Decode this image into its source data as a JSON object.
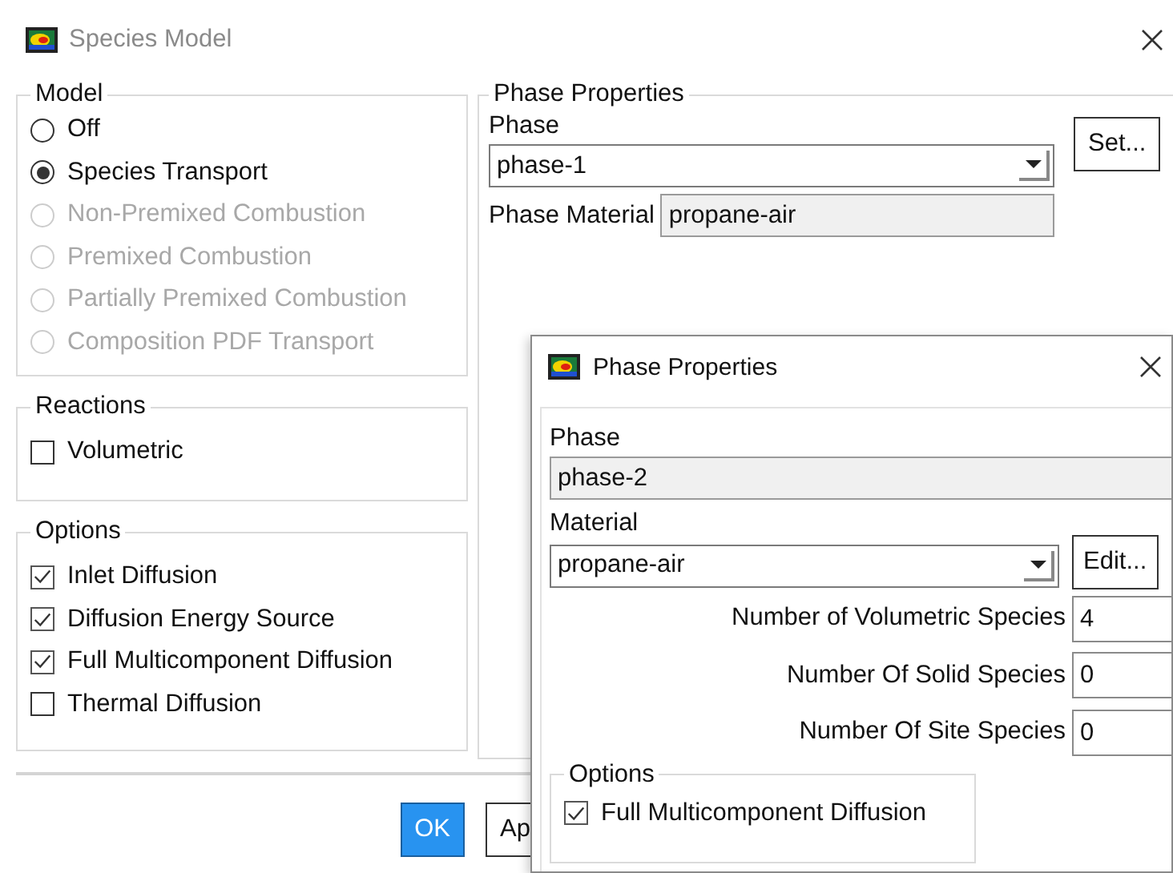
{
  "window": {
    "title": "Species Model"
  },
  "model": {
    "title": "Model",
    "options": [
      {
        "label": "Off",
        "selected": false,
        "disabled": false
      },
      {
        "label": "Species Transport",
        "selected": true,
        "disabled": false
      },
      {
        "label": "Non-Premixed Combustion",
        "selected": false,
        "disabled": true
      },
      {
        "label": "Premixed Combustion",
        "selected": false,
        "disabled": true
      },
      {
        "label": "Partially Premixed Combustion",
        "selected": false,
        "disabled": true
      },
      {
        "label": "Composition PDF Transport",
        "selected": false,
        "disabled": true
      }
    ]
  },
  "reactions": {
    "title": "Reactions",
    "items": [
      {
        "label": "Volumetric",
        "checked": false
      }
    ]
  },
  "options": {
    "title": "Options",
    "items": [
      {
        "label": "Inlet Diffusion",
        "checked": true
      },
      {
        "label": "Diffusion Energy Source",
        "checked": true
      },
      {
        "label": "Full Multicomponent Diffusion",
        "checked": true
      },
      {
        "label": "Thermal Diffusion",
        "checked": false
      }
    ]
  },
  "phase_properties": {
    "title": "Phase Properties",
    "phase_label": "Phase",
    "phase_value": "phase-1",
    "set_button": "Set...",
    "material_label": "Phase Material",
    "material_value": "propane-air"
  },
  "buttons": [
    {
      "label": "OK",
      "primary": true
    },
    {
      "label": "Ap",
      "primary": false
    }
  ],
  "dialog": {
    "title": "Phase Properties",
    "phase_label": "Phase",
    "phase_value": "phase-2",
    "material_label": "Material",
    "material_value": "propane-air",
    "edit_button": "Edit...",
    "fields": [
      {
        "label": "Number of Volumetric Species",
        "value": "4"
      },
      {
        "label": "Number Of Solid Species",
        "value": "0"
      },
      {
        "label": "Number Of Site Species",
        "value": "0"
      }
    ],
    "options": {
      "title": "Options",
      "items": [
        {
          "label": "Full Multicomponent Diffusion",
          "checked": true
        }
      ]
    }
  }
}
